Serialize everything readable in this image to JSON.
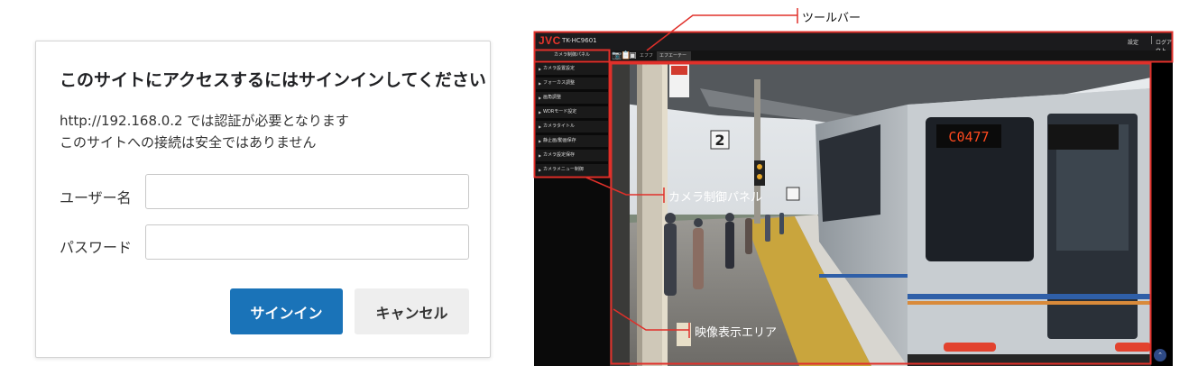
{
  "signin": {
    "title": "このサイトにアクセスするにはサインインしてください",
    "message1": "http://192.168.0.2 では認証が必要となります",
    "message2": "このサイトへの接続は安全ではありません",
    "username_label": "ユーザー名",
    "username_value": "",
    "password_label": "パスワード",
    "password_value": "",
    "signin_button": "サインイン",
    "cancel_button": "キャンセル"
  },
  "app": {
    "logo": "JVC",
    "model": "TK-HC9601",
    "header_right_1": "設定",
    "header_right_2": "ログアウト",
    "toolbar": {
      "icons": [
        "camera-icon",
        "clipboard-icon",
        "image-icon"
      ],
      "tabs": [
        "エフフーテ",
        "エフエーテーネ"
      ]
    },
    "panel": {
      "title": "カメラ制御パネル",
      "items": [
        "カメラ設置設定",
        "フォーカス調整",
        "画角調整",
        "WDRモード設定",
        "カメラタイトル",
        "静止画/動画保存",
        "カメラ設定保存",
        "カメラメニュー制御"
      ]
    },
    "video": {
      "train_number": "C0477",
      "platform_number": "2"
    }
  },
  "annotations": {
    "toolbar": "ツールバー",
    "camera_panel": "カメラ制御パネル",
    "video_area": "映像表示エリア"
  },
  "colors": {
    "annotation_red": "#e0302a",
    "primary_button": "#1a73b8",
    "logo_red": "#e5352b"
  }
}
